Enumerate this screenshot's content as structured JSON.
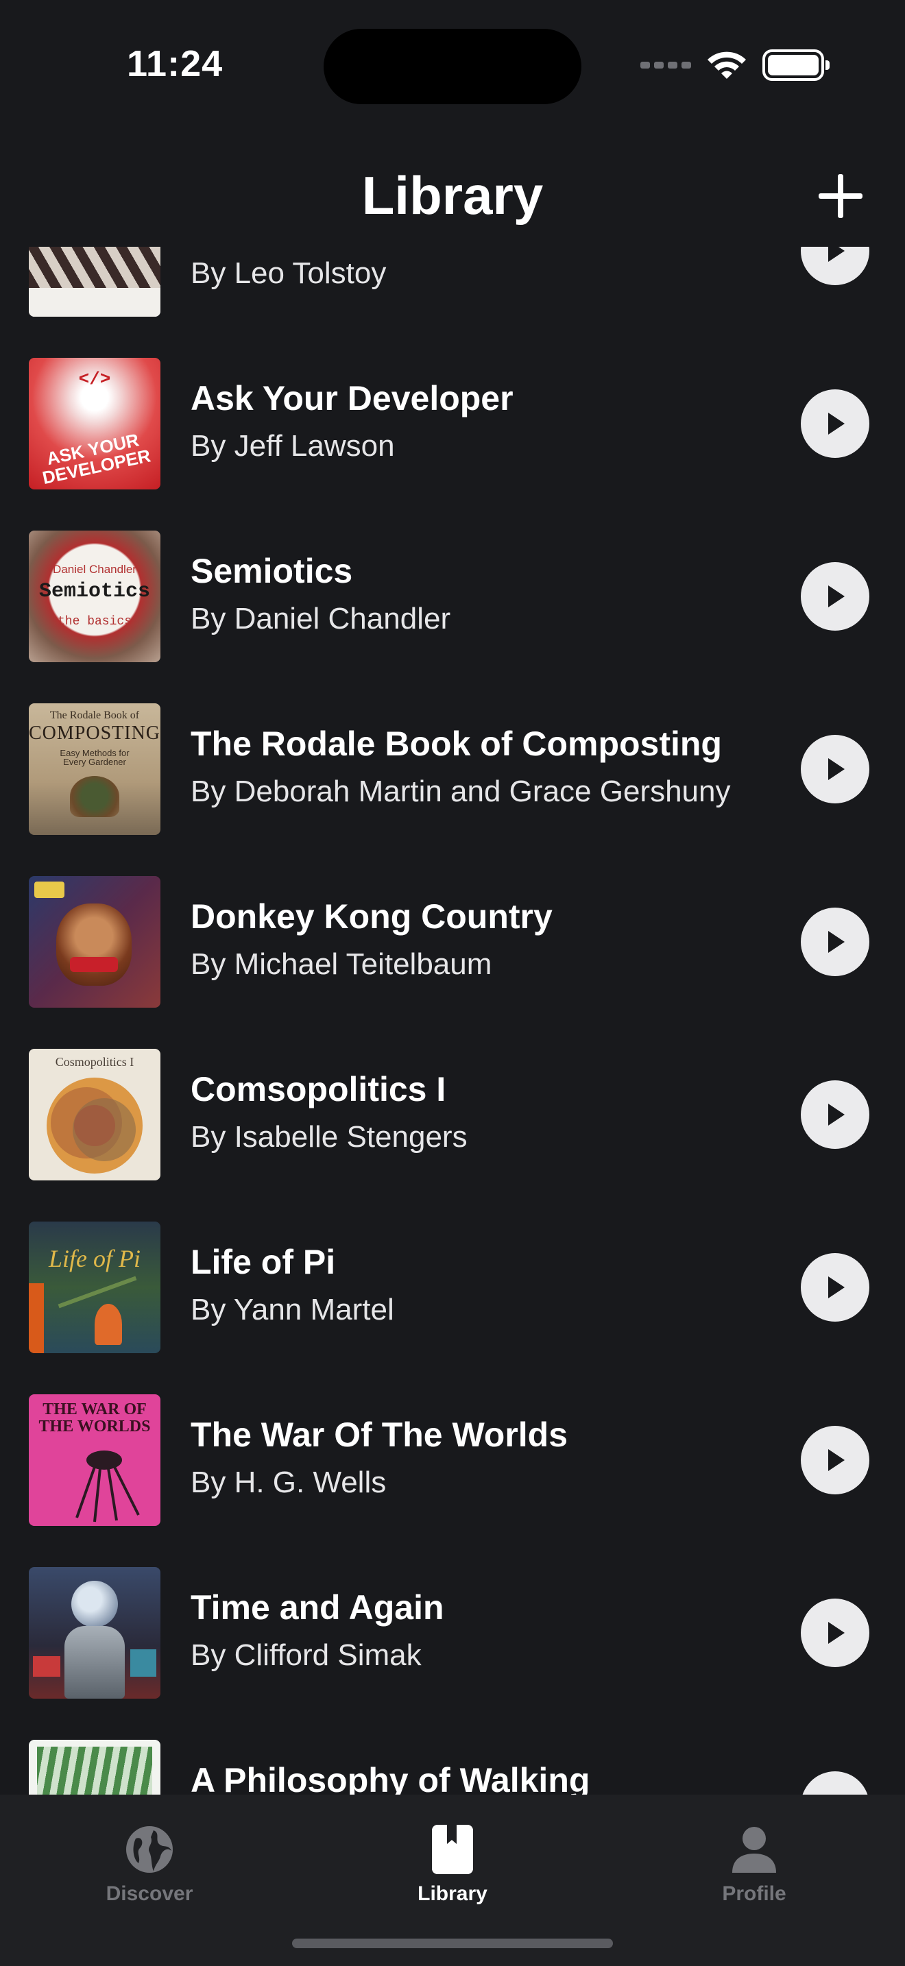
{
  "status_bar": {
    "time": "11:24"
  },
  "header": {
    "title": "Library"
  },
  "books": [
    {
      "title": "",
      "author": "By Leo Tolstoy"
    },
    {
      "title": "Ask Your Developer",
      "author": "By Jeff Lawson"
    },
    {
      "title": "Semiotics",
      "author": "By Daniel Chandler"
    },
    {
      "title": "The Rodale Book of Composting",
      "author": "By Deborah Martin and Grace Gershuny"
    },
    {
      "title": "Donkey Kong Country",
      "author": "By Michael Teitelbaum"
    },
    {
      "title": "Comsopolitics I",
      "author": "By Isabelle Stengers"
    },
    {
      "title": "Life of Pi",
      "author": "By Yann Martel"
    },
    {
      "title": "The War Of The Worlds",
      "author": "By H. G. Wells"
    },
    {
      "title": "Time and Again",
      "author": "By Clifford Simak"
    },
    {
      "title": "A Philosophy of Walking",
      "author": ""
    }
  ],
  "covers": {
    "ask_your_developer": {
      "line1": "ASK YOUR DEVELOPER"
    },
    "semiotics": {
      "line1": "Daniel Chandler",
      "line2": "Semiotics",
      "line3": "the basics"
    },
    "composting": {
      "line1": "The Rodale Book of",
      "line2": "COMPOSTING",
      "line3": "Easy Methods for Every Gardener"
    },
    "cosmopolitics": {
      "line1": "Cosmopolitics I"
    },
    "life_of_pi": {
      "line1": "Life of Pi"
    },
    "war_of_worlds": {
      "line1": "THE WAR OF THE WORLDS"
    }
  },
  "tab_bar": {
    "tabs": [
      {
        "label": "Discover",
        "icon": "globe-icon"
      },
      {
        "label": "Library",
        "icon": "book-icon"
      },
      {
        "label": "Profile",
        "icon": "person-icon"
      }
    ],
    "active": "Library"
  },
  "colors": {
    "background": "#18191c",
    "tab_bar": "#1f2023",
    "inactive_tab": "#75767b",
    "play_button": "#ebebed"
  }
}
